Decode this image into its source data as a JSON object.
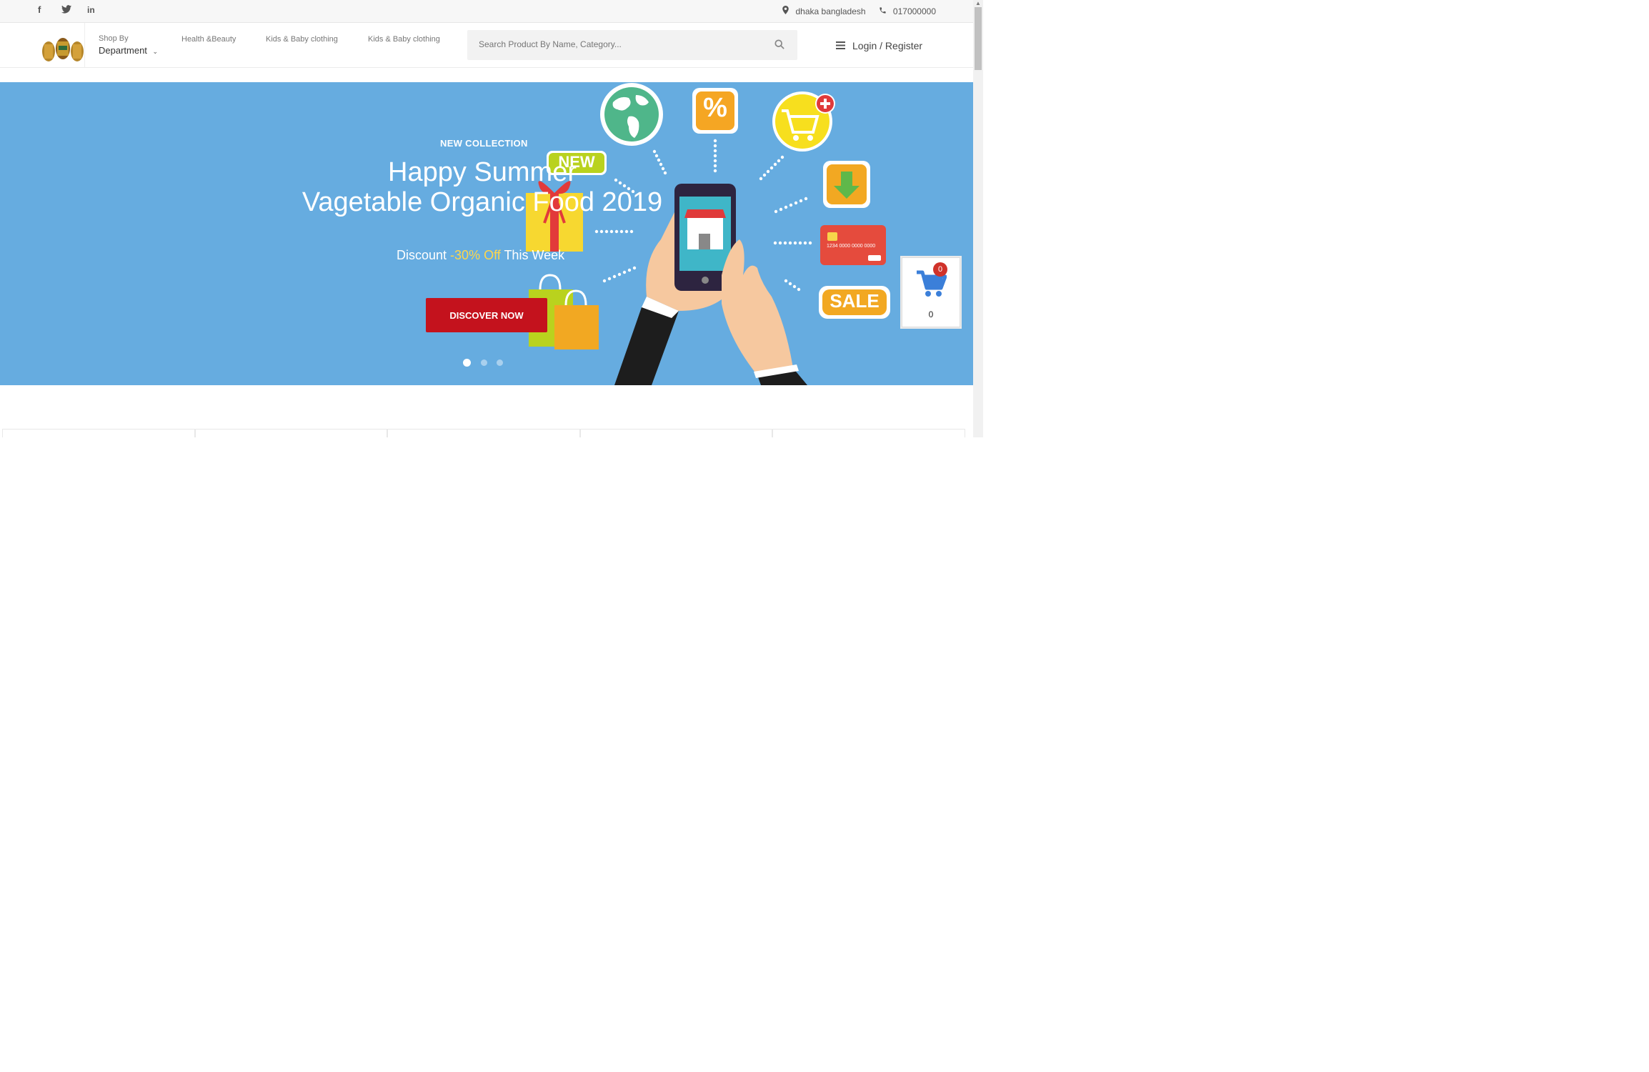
{
  "topbar": {
    "social": [
      "f",
      "t",
      "in"
    ],
    "location": "dhaka bangladesh",
    "phone": "017000000",
    "icons": [
      "facebook-icon",
      "twitter-icon",
      "linkedin-icon",
      "map-marker-icon",
      "phone-icon"
    ]
  },
  "header": {
    "shop_by_small": "Shop By",
    "shop_by_big": "Department",
    "nav": [
      "Health &Beauty",
      "Kids & Baby clothing",
      "Kids & Baby clothing"
    ],
    "search_placeholder": "Search Product By Name, Category...",
    "login_label": "Login / Register"
  },
  "hero": {
    "kicker": "NEW COLLECTION",
    "title_line1": "Happy Summer",
    "title_line2": "Vagetable Organic Food 2019",
    "discount_prefix": "Discount",
    "discount_highlight": "-30% Off",
    "discount_suffix": "This Week",
    "cta": "DISCOVER NOW",
    "slides": 3,
    "active_slide": 1,
    "illustration_labels": [
      "NEW",
      "%",
      "SALE"
    ],
    "card_text": "1234 0000 0000 0000",
    "bg_color": "#66ace0"
  },
  "cart": {
    "badge": "0",
    "count": "0"
  },
  "colors": {
    "accent_red": "#c4121d",
    "highlight_yellow": "#ffd64a"
  }
}
